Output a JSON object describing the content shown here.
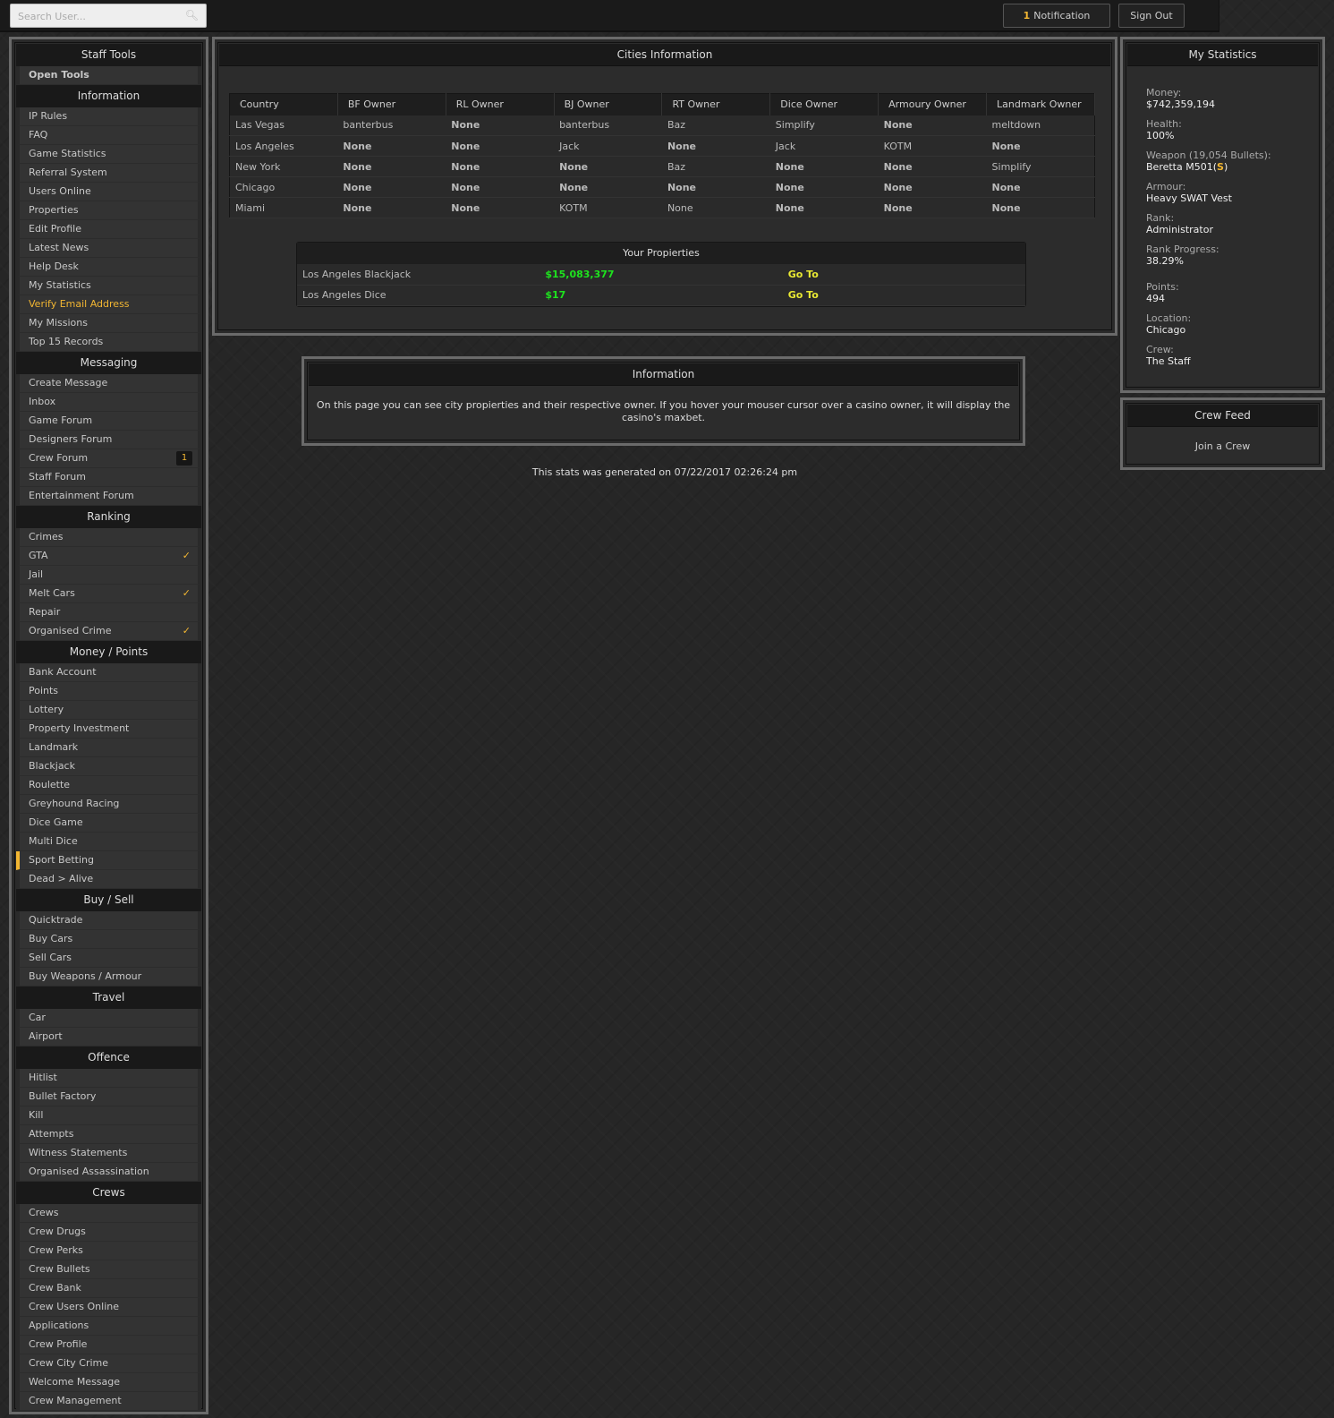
{
  "topbar": {
    "search_placeholder": "Search User...",
    "notification_count": "1",
    "notification_label": "Notification",
    "sign_out": "Sign Out"
  },
  "sidebar": [
    {
      "title": "Staff Tools",
      "items": [
        {
          "label": "Open Tools",
          "bold": true
        }
      ]
    },
    {
      "title": "Information",
      "items": [
        {
          "label": "IP Rules"
        },
        {
          "label": "FAQ"
        },
        {
          "label": "Game Statistics"
        },
        {
          "label": "Referral System"
        },
        {
          "label": "Users Online"
        },
        {
          "label": "Properties"
        },
        {
          "label": "Edit Profile"
        },
        {
          "label": "Latest News"
        },
        {
          "label": "Help Desk"
        },
        {
          "label": "My Statistics"
        },
        {
          "label": "Verify Email Address",
          "highlight": true
        },
        {
          "label": "My Missions"
        },
        {
          "label": "Top 15 Records"
        }
      ]
    },
    {
      "title": "Messaging",
      "items": [
        {
          "label": "Create Message"
        },
        {
          "label": "Inbox"
        },
        {
          "label": "Game Forum"
        },
        {
          "label": "Designers Forum"
        },
        {
          "label": "Crew Forum",
          "badge": "1"
        },
        {
          "label": "Staff Forum"
        },
        {
          "label": "Entertainment Forum"
        }
      ]
    },
    {
      "title": "Ranking",
      "items": [
        {
          "label": "Crimes"
        },
        {
          "label": "GTA",
          "check": true
        },
        {
          "label": "Jail"
        },
        {
          "label": "Melt Cars",
          "check": true
        },
        {
          "label": "Repair"
        },
        {
          "label": "Organised Crime",
          "check": true
        }
      ]
    },
    {
      "title": "Money / Points",
      "items": [
        {
          "label": "Bank Account"
        },
        {
          "label": "Points"
        },
        {
          "label": "Lottery"
        },
        {
          "label": "Property Investment"
        },
        {
          "label": "Landmark"
        },
        {
          "label": "Blackjack"
        },
        {
          "label": "Roulette"
        },
        {
          "label": "Greyhound Racing"
        },
        {
          "label": "Dice Game"
        },
        {
          "label": "Multi Dice"
        },
        {
          "label": "Sport Betting",
          "active": true
        },
        {
          "label": "Dead > Alive"
        }
      ]
    },
    {
      "title": "Buy / Sell",
      "items": [
        {
          "label": "Quicktrade"
        },
        {
          "label": "Buy Cars"
        },
        {
          "label": "Sell Cars"
        },
        {
          "label": "Buy Weapons / Armour"
        }
      ]
    },
    {
      "title": "Travel",
      "items": [
        {
          "label": "Car"
        },
        {
          "label": "Airport"
        }
      ]
    },
    {
      "title": "Offence",
      "items": [
        {
          "label": "Hitlist"
        },
        {
          "label": "Bullet Factory"
        },
        {
          "label": "Kill"
        },
        {
          "label": "Attempts"
        },
        {
          "label": "Witness Statements"
        },
        {
          "label": "Organised Assassination"
        }
      ]
    },
    {
      "title": "Crews",
      "items": [
        {
          "label": "Crews"
        },
        {
          "label": "Crew Drugs"
        },
        {
          "label": "Crew Perks"
        },
        {
          "label": "Crew Bullets"
        },
        {
          "label": "Crew Bank"
        },
        {
          "label": "Crew Users Online"
        },
        {
          "label": "Applications"
        },
        {
          "label": "Crew Profile"
        },
        {
          "label": "Crew City Crime"
        },
        {
          "label": "Welcome Message"
        },
        {
          "label": "Crew Management"
        }
      ]
    }
  ],
  "cities": {
    "title": "Cities Information",
    "headers": [
      "Country",
      "BF Owner",
      "RL Owner",
      "BJ Owner",
      "RT Owner",
      "Dice Owner",
      "Armoury Owner",
      "Landmark Owner"
    ],
    "rows": [
      [
        {
          "t": "Las Vegas"
        },
        {
          "t": "banterbus"
        },
        {
          "t": "None",
          "b": true
        },
        {
          "t": "banterbus"
        },
        {
          "t": "Baz"
        },
        {
          "t": "Simplify"
        },
        {
          "t": "None",
          "b": true
        },
        {
          "t": "meltdown"
        }
      ],
      [
        {
          "t": "Los Angeles"
        },
        {
          "t": "None",
          "b": true
        },
        {
          "t": "None",
          "b": true
        },
        {
          "t": "Jack"
        },
        {
          "t": "None",
          "b": true
        },
        {
          "t": "Jack"
        },
        {
          "t": "KOTM"
        },
        {
          "t": "None",
          "b": true
        }
      ],
      [
        {
          "t": "New York"
        },
        {
          "t": "None",
          "b": true
        },
        {
          "t": "None",
          "b": true
        },
        {
          "t": "None",
          "b": true
        },
        {
          "t": "Baz"
        },
        {
          "t": "None",
          "b": true
        },
        {
          "t": "None",
          "b": true
        },
        {
          "t": "Simplify"
        }
      ],
      [
        {
          "t": "Chicago"
        },
        {
          "t": "None",
          "b": true
        },
        {
          "t": "None",
          "b": true
        },
        {
          "t": "None",
          "b": true
        },
        {
          "t": "None",
          "b": true
        },
        {
          "t": "None",
          "b": true
        },
        {
          "t": "None",
          "b": true
        },
        {
          "t": "None",
          "b": true
        }
      ],
      [
        {
          "t": "Miami"
        },
        {
          "t": "None",
          "b": true
        },
        {
          "t": "None",
          "b": true
        },
        {
          "t": "KOTM"
        },
        {
          "t": "None"
        },
        {
          "t": "None",
          "b": true
        },
        {
          "t": "None",
          "b": true
        },
        {
          "t": "None",
          "b": true
        }
      ]
    ]
  },
  "properties": {
    "title": "Your Propierties",
    "rows": [
      {
        "name": "Los Angeles Blackjack",
        "value": "$15,083,377",
        "action": "Go To"
      },
      {
        "name": "Los Angeles Dice",
        "value": "$17",
        "action": "Go To"
      }
    ]
  },
  "info": {
    "title": "Information",
    "text": "On this page you can see city propierties and their respective owner. If you hover your mouser cursor over a casino owner, it will display the casino's maxbet."
  },
  "footer": "This stats was generated on 07/22/2017 02:26:24 pm",
  "stats": {
    "title": "My Statistics",
    "money_label": "Money:",
    "money": "$742,359,194",
    "health_label": "Health:",
    "health": "100%",
    "weapon_label": "Weapon (19,054 Bullets):",
    "weapon": "Beretta M501(",
    "weapon_tag": "S",
    "weapon_close": ")",
    "armour_label": "Armour:",
    "armour": "Heavy SWAT Vest",
    "rank_label": "Rank:",
    "rank": "Administrator",
    "progress_label": "Rank Progress:",
    "progress": "38.29%",
    "points_label": "Points:",
    "points": "494",
    "location_label": "Location:",
    "location": "Chicago",
    "crew_label": "Crew:",
    "crew": "The Staff"
  },
  "crew_feed": {
    "title": "Crew Feed",
    "link": "Join a Crew"
  },
  "colors": {
    "accent": "#f2b632",
    "money_green": "#1ee31e",
    "goto_yellow": "#e8e833"
  }
}
